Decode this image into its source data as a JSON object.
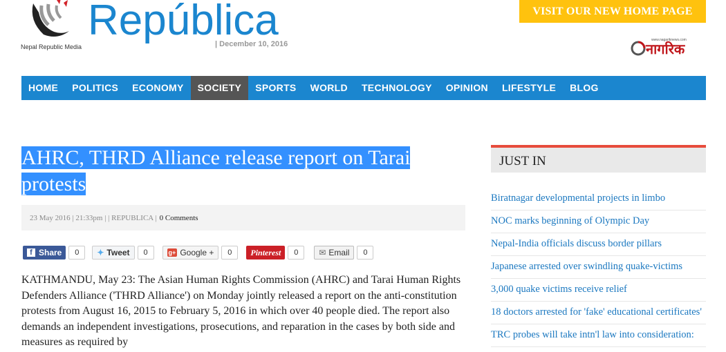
{
  "header": {
    "brand": "República",
    "tagline": "Nepal Republic Media",
    "date": "| December 10, 2016",
    "visit_button": "VISIT OUR NEW HOME PAGE",
    "partner_logo_text": "नागरिक",
    "partner_logo_small": "www.nagariknews.com"
  },
  "nav": {
    "items": [
      {
        "label": "HOME"
      },
      {
        "label": "POLITICS"
      },
      {
        "label": "ECONOMY"
      },
      {
        "label": "SOCIETY",
        "active": true
      },
      {
        "label": "SPORTS"
      },
      {
        "label": "WORLD"
      },
      {
        "label": "TECHNOLOGY"
      },
      {
        "label": "OPINION"
      },
      {
        "label": "LIFESTYLE"
      },
      {
        "label": "BLOG"
      }
    ]
  },
  "article": {
    "title": "AHRC, THRD Alliance release report on Tarai protests",
    "meta": "23 May 2016 | 21:33pm |  |  REPUBLICA |",
    "comments": "0 Comments",
    "body": "KATHMANDU, May 23: The Asian Human Rights Commission (AHRC) and Tarai Human Rights Defenders Alliance ('THRD Alliance') on Monday jointly released a report on the anti-constitution protests from August 16, 2015 to February 5, 2016 in which over 40 people died. The report also demands an independent investigations, prosecutions, and reparation in the cases by both side and measures as required by"
  },
  "share": {
    "facebook": {
      "label": "Share",
      "count": "0"
    },
    "twitter": {
      "label": "Tweet",
      "count": "0"
    },
    "google": {
      "label": "Google +",
      "count": "0"
    },
    "pinterest": {
      "label": "Pinterest",
      "count": "0"
    },
    "email": {
      "label": "Email",
      "count": "0"
    }
  },
  "sidebar": {
    "heading": "JUST IN",
    "items": [
      "Biratnagar developmental projects in limbo",
      "NOC marks beginning of Olympic Day",
      "Nepal-India officials discuss border pillars",
      "Japanese arrested over swindling quake-victims",
      "3,000 quake victims receive relief",
      "18 doctors arrested for 'fake' educational certificates'",
      "TRC probes will take intn'l law into consideration:"
    ]
  },
  "colors": {
    "brand_blue": "#1b86cf",
    "active_nav": "#555555",
    "visit_yellow": "#ffc20e",
    "selection": "#3390ff",
    "accent_red": "#e74c3c"
  }
}
